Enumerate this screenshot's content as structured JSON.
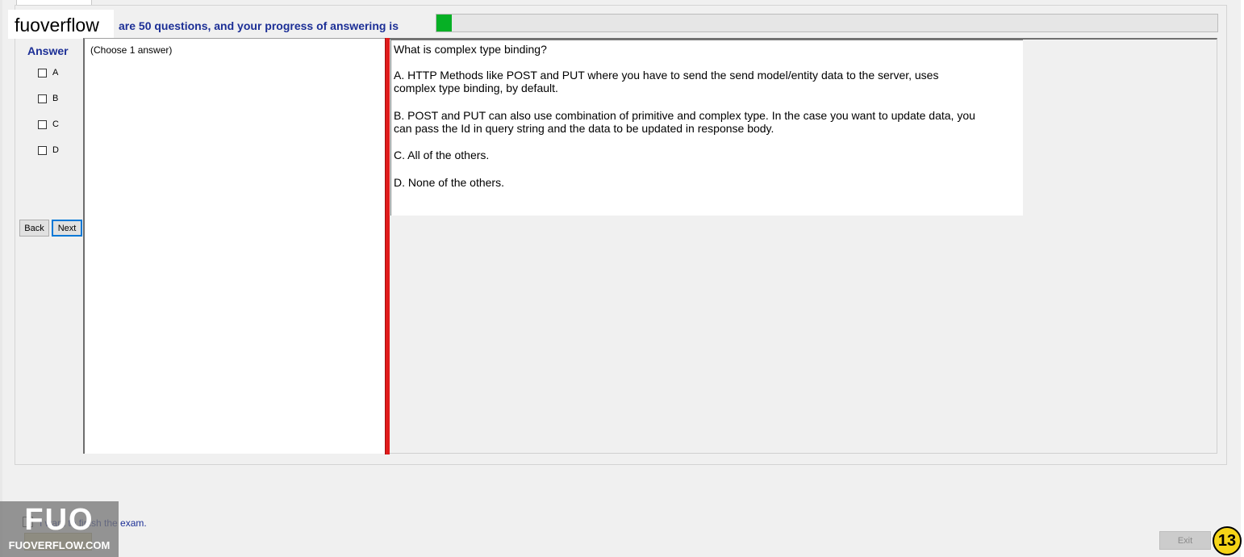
{
  "header": {
    "logo_text": "fuoverflow",
    "progress_text": "are 50 questions, and your progress of answering is",
    "progress_fraction": 0.02,
    "progress_color": "#06b025"
  },
  "answer_panel": {
    "title": "Answer",
    "options": [
      "A",
      "B",
      "C",
      "D"
    ],
    "back_label": "Back",
    "next_label": "Next"
  },
  "left_pane": {
    "instruction": "(Choose 1 answer)"
  },
  "question": {
    "title": "What is complex type binding?",
    "option_a": "A.  HTTP Methods like POST and PUT where you have to send the send model/entity data to the server, uses complex type binding, by default.",
    "option_b": "B.  POST and PUT can also use combination of primitive and complex type. In the case you want to update data, you can pass the Id in query string and the data to be updated in response body.",
    "option_c": "C.  All of the others.",
    "option_d": "D.  None of the others."
  },
  "footer": {
    "finish_label": "I want to finish the exam.",
    "exit_label": "Exit",
    "page_number": "13"
  },
  "watermark": {
    "big_text": "FUO",
    "small_text": "FUOVERFLOW.COM"
  },
  "colors": {
    "accent_blue": "#1c2f96",
    "splitter_red": "#e01b1b",
    "badge_yellow": "#f5d417"
  }
}
